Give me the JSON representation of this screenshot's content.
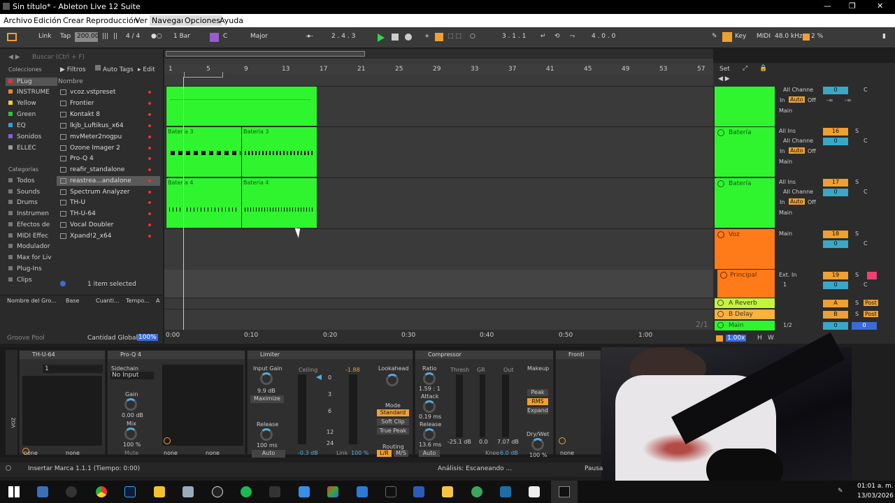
{
  "window": {
    "title": "Sin título* - Ableton Live 12 Suite"
  },
  "menu": [
    "Archivo",
    "Edición",
    "Crear",
    "Reproducción",
    "Ver",
    "Navegar",
    "Opciones",
    "Ayuda"
  ],
  "transport": {
    "link": "Link",
    "tap": "Tap",
    "tempo": "200.00",
    "time_sig": "4 / 4",
    "quantize": "1 Bar",
    "key": "C",
    "scale": "Major",
    "position": "2 .  4 .  3",
    "loop_start": "3 .  1 .  1",
    "loop_length": "4 .  0 .  0",
    "key_label": "Key",
    "midi_label": "MIDI",
    "sample_rate": "48.0 kHz",
    "cpu": "2 %"
  },
  "browser": {
    "search_placeholder": "Buscar (Ctrl + F)",
    "collections_title": "Colecciones",
    "collections": [
      {
        "name": "PLug",
        "color": "#e3323c"
      },
      {
        "name": "INSTRUME",
        "color": "#e98a2a"
      },
      {
        "name": "Yellow",
        "color": "#e8d33a"
      },
      {
        "name": "Green",
        "color": "#2fc23a"
      },
      {
        "name": "EQ",
        "color": "#2aa0e8"
      },
      {
        "name": "Sonidos",
        "color": "#8a5ce8"
      },
      {
        "name": "ELLEC",
        "color": "#9a9a9a"
      }
    ],
    "categories_title": "Categorías",
    "categories": [
      "Todos",
      "Sounds",
      "Drums",
      "Instrumen",
      "Efectos de",
      "MIDI Effec",
      "Modulador",
      "Max for Liv",
      "Plug-Ins",
      "Clips"
    ],
    "filters": "Filtros",
    "autotags": "Auto Tags",
    "edit": "Edit",
    "name_col": "Nombre",
    "files": [
      "vcoz.vstpreset",
      "Frontier",
      "Kontakt 8",
      "lkjb_Luftikus_x64",
      "mvMeter2nogpu",
      "Ozone Imager 2",
      "Pro-Q 4",
      "reafir_standalone",
      "reastrea...andalone",
      "Spectrum Analyzer",
      "TH-U",
      "TH-U-64",
      "Vocal Doubler",
      "Xpand!2_x64"
    ],
    "selected": "1 item selected",
    "groove_cols": [
      "Nombre del Gro...",
      "Base",
      "Cuanti...",
      "Tempo...",
      "A"
    ],
    "groove_pool": "Groove Pool",
    "global": "Cantidad Global",
    "global_val": "100%"
  },
  "arrangement": {
    "bar_markers": [
      "1",
      "5",
      "9",
      "13",
      "17",
      "21",
      "25",
      "29",
      "33",
      "37",
      "41",
      "45",
      "49",
      "53",
      "57"
    ],
    "time_markers": [
      "0:00",
      "0:10",
      "0:20",
      "0:30",
      "0:40",
      "0:50",
      "1:00"
    ],
    "clips": [
      "Batería 3",
      "Batería 3",
      "Batería 4",
      "Batería 4"
    ],
    "zoom": "2/1"
  },
  "tracks": [
    {
      "name": "",
      "color": "#2ef52e",
      "input": "All Channe",
      "num": "",
      "route": "Main"
    },
    {
      "name": "Batería",
      "color": "#2ef52e",
      "input": "All Ins",
      "num": "16",
      "route": "Main"
    },
    {
      "name": "Batería",
      "color": "#2ef52e",
      "input": "All Ins",
      "num": "17",
      "route": "Main"
    },
    {
      "name": "Voz",
      "color": "#ff7a18",
      "input": "",
      "num": "18",
      "route": "Main"
    },
    {
      "name": "Principal",
      "color": "#ff7a18",
      "input": "Ext. In",
      "num": "19",
      "route": "1"
    },
    {
      "name": "A Reverb",
      "color": "#c4f53a",
      "input": "",
      "num": "A",
      "route": "Post"
    },
    {
      "name": "B Delay",
      "color": "#ffb13a",
      "input": "",
      "num": "B",
      "route": "Post"
    },
    {
      "name": "Main",
      "color": "#2ef52e",
      "input": "1/2",
      "num": "0",
      "route": "0"
    }
  ],
  "mixer": {
    "set": "Set",
    "auto": "Auto",
    "in": "In",
    "off": "Off",
    "zero": "0",
    "c": "C",
    "neg_inf": "-∞",
    "s": "S",
    "zoom_val": "1.00x",
    "h": "H",
    "w": "W"
  },
  "devices": {
    "thu": "TH-U-64",
    "proq": "Pro-Q 4",
    "limiter": "Limiter",
    "compressor": "Compressor",
    "frontier": "Fronti",
    "thu_preset": "1",
    "sidechain": "Sidechain",
    "no_input": "No Input",
    "gain": "Gain",
    "gain_val": "0.00 dB",
    "mix": "Mix",
    "mix_val": "100 %",
    "mute": "Mute",
    "none": "none",
    "lim_input_gain": "Input Gain",
    "lim_input_val": "9.9 dB",
    "maximize": "Maximize",
    "release": "Release",
    "release_val": "100 ms",
    "auto": "Auto",
    "ceiling": "Ceiling",
    "ceiling_val": "-1.88",
    "ceil_scale": [
      "0",
      "3",
      "6",
      "12",
      "24"
    ],
    "ceiling_db": "-0.3 dB",
    "link": "Link",
    "link_val": "100 %",
    "lookahead": "Lookahead",
    "mode": "Mode",
    "standard": "Standard",
    "soft_clip": "Soft Clip",
    "true_peak": "True Peak",
    "routing": "Routing",
    "lr": "L/R",
    "ms": "M/S",
    "ratio": "Ratio",
    "ratio_val": "1.59 : 1",
    "attack": "Attack",
    "attack_val": "0.19 ms",
    "comp_release": "Release",
    "comp_release_val": "13.6 ms",
    "thresh": "Thresh",
    "gr": "GR",
    "out": "Out",
    "thresh_val": "-25.1 dB",
    "gr_val": "0.0",
    "out_val": "7.07 dB",
    "knee": "Knee",
    "knee_val": "6.0 dB",
    "makeup": "Makeup",
    "peak": "Peak",
    "rms": "RMS",
    "expand": "Expand",
    "drywet": "Dry/Wet",
    "drywet_val": "100 %",
    "track_label": "VOZ"
  },
  "status": {
    "left": "Insertar Marca 1.1.1 (Tiempo: 0:00)",
    "center": "Análisis: Escaneando ...",
    "pause": "Pausa"
  },
  "taskbar": {
    "time": "01:01 a. m.",
    "date": "13/03/2026"
  }
}
